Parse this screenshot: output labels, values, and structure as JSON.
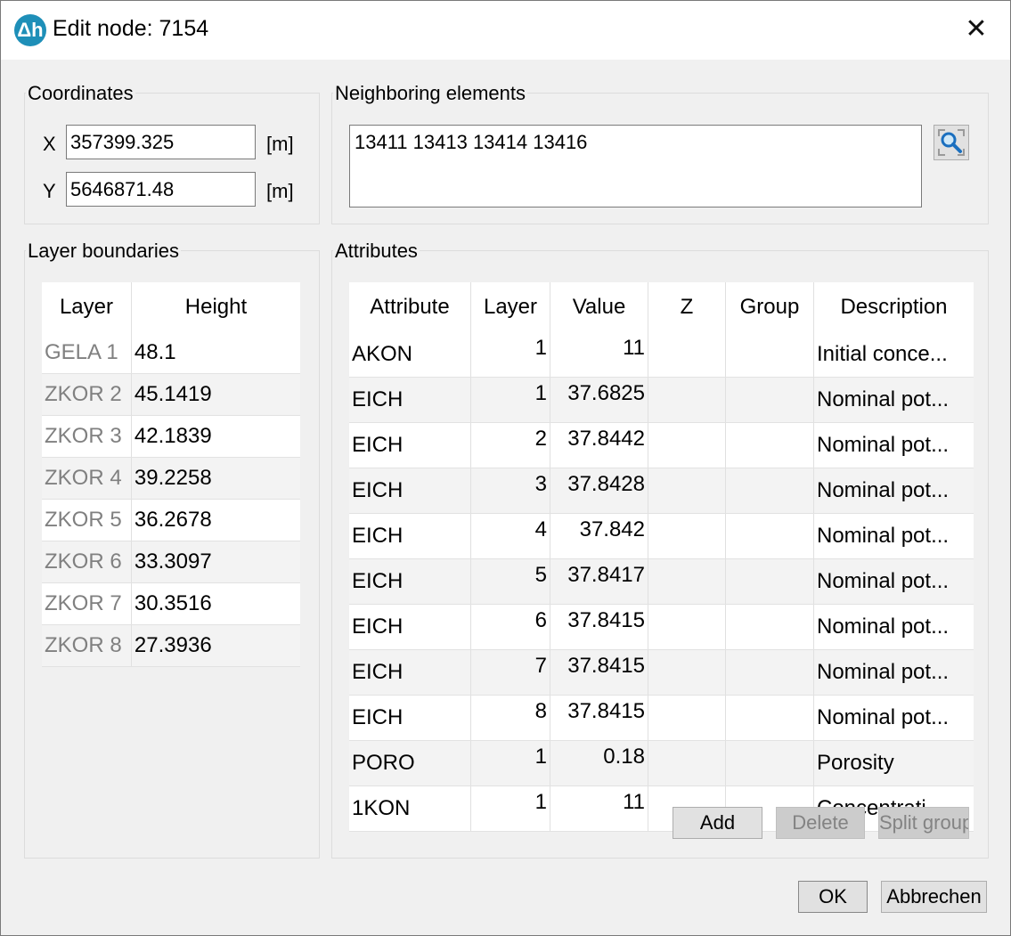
{
  "window": {
    "title": "Edit node: 7154",
    "icon": "delta-h-icon"
  },
  "coordinates": {
    "label": "Coordinates",
    "x_label": "X",
    "x_value": "357399.325",
    "x_unit": "[m]",
    "y_label": "Y",
    "y_value": "5646871.48",
    "y_unit": "[m]"
  },
  "neighbors": {
    "label": "Neighboring elements",
    "value": "13411 13413 13414 13416"
  },
  "layers": {
    "label": "Layer boundaries",
    "headers": [
      "Layer",
      "Height"
    ],
    "rows": [
      [
        "GELA 1",
        "48.1"
      ],
      [
        "ZKOR 2",
        "45.1419"
      ],
      [
        "ZKOR 3",
        "42.1839"
      ],
      [
        "ZKOR 4",
        "39.2258"
      ],
      [
        "ZKOR 5",
        "36.2678"
      ],
      [
        "ZKOR 6",
        "33.3097"
      ],
      [
        "ZKOR 7",
        "30.3516"
      ],
      [
        "ZKOR 8",
        "27.3936"
      ]
    ]
  },
  "attributes": {
    "label": "Attributes",
    "headers": [
      "Attribute",
      "Layer",
      "Value",
      "Z",
      "Group",
      "Description"
    ],
    "rows": [
      [
        "AKON",
        "1",
        "11",
        "",
        "",
        "Initial conce..."
      ],
      [
        "EICH",
        "1",
        "37.6825",
        "",
        "",
        "Nominal pot..."
      ],
      [
        "EICH",
        "2",
        "37.8442",
        "",
        "",
        "Nominal pot..."
      ],
      [
        "EICH",
        "3",
        "37.8428",
        "",
        "",
        "Nominal pot..."
      ],
      [
        "EICH",
        "4",
        "37.842",
        "",
        "",
        "Nominal pot..."
      ],
      [
        "EICH",
        "5",
        "37.8417",
        "",
        "",
        "Nominal pot..."
      ],
      [
        "EICH",
        "6",
        "37.8415",
        "",
        "",
        "Nominal pot..."
      ],
      [
        "EICH",
        "7",
        "37.8415",
        "",
        "",
        "Nominal pot..."
      ],
      [
        "EICH",
        "8",
        "37.8415",
        "",
        "",
        "Nominal pot..."
      ],
      [
        "PORO",
        "1",
        "0.18",
        "",
        "",
        "Porosity"
      ],
      [
        "1KON",
        "1",
        "11",
        "",
        "",
        "Concentrati..."
      ]
    ],
    "add_label": "Add",
    "delete_label": "Delete",
    "split_label": "Split group"
  },
  "footer": {
    "ok_label": "OK",
    "cancel_label": "Abbrechen"
  }
}
